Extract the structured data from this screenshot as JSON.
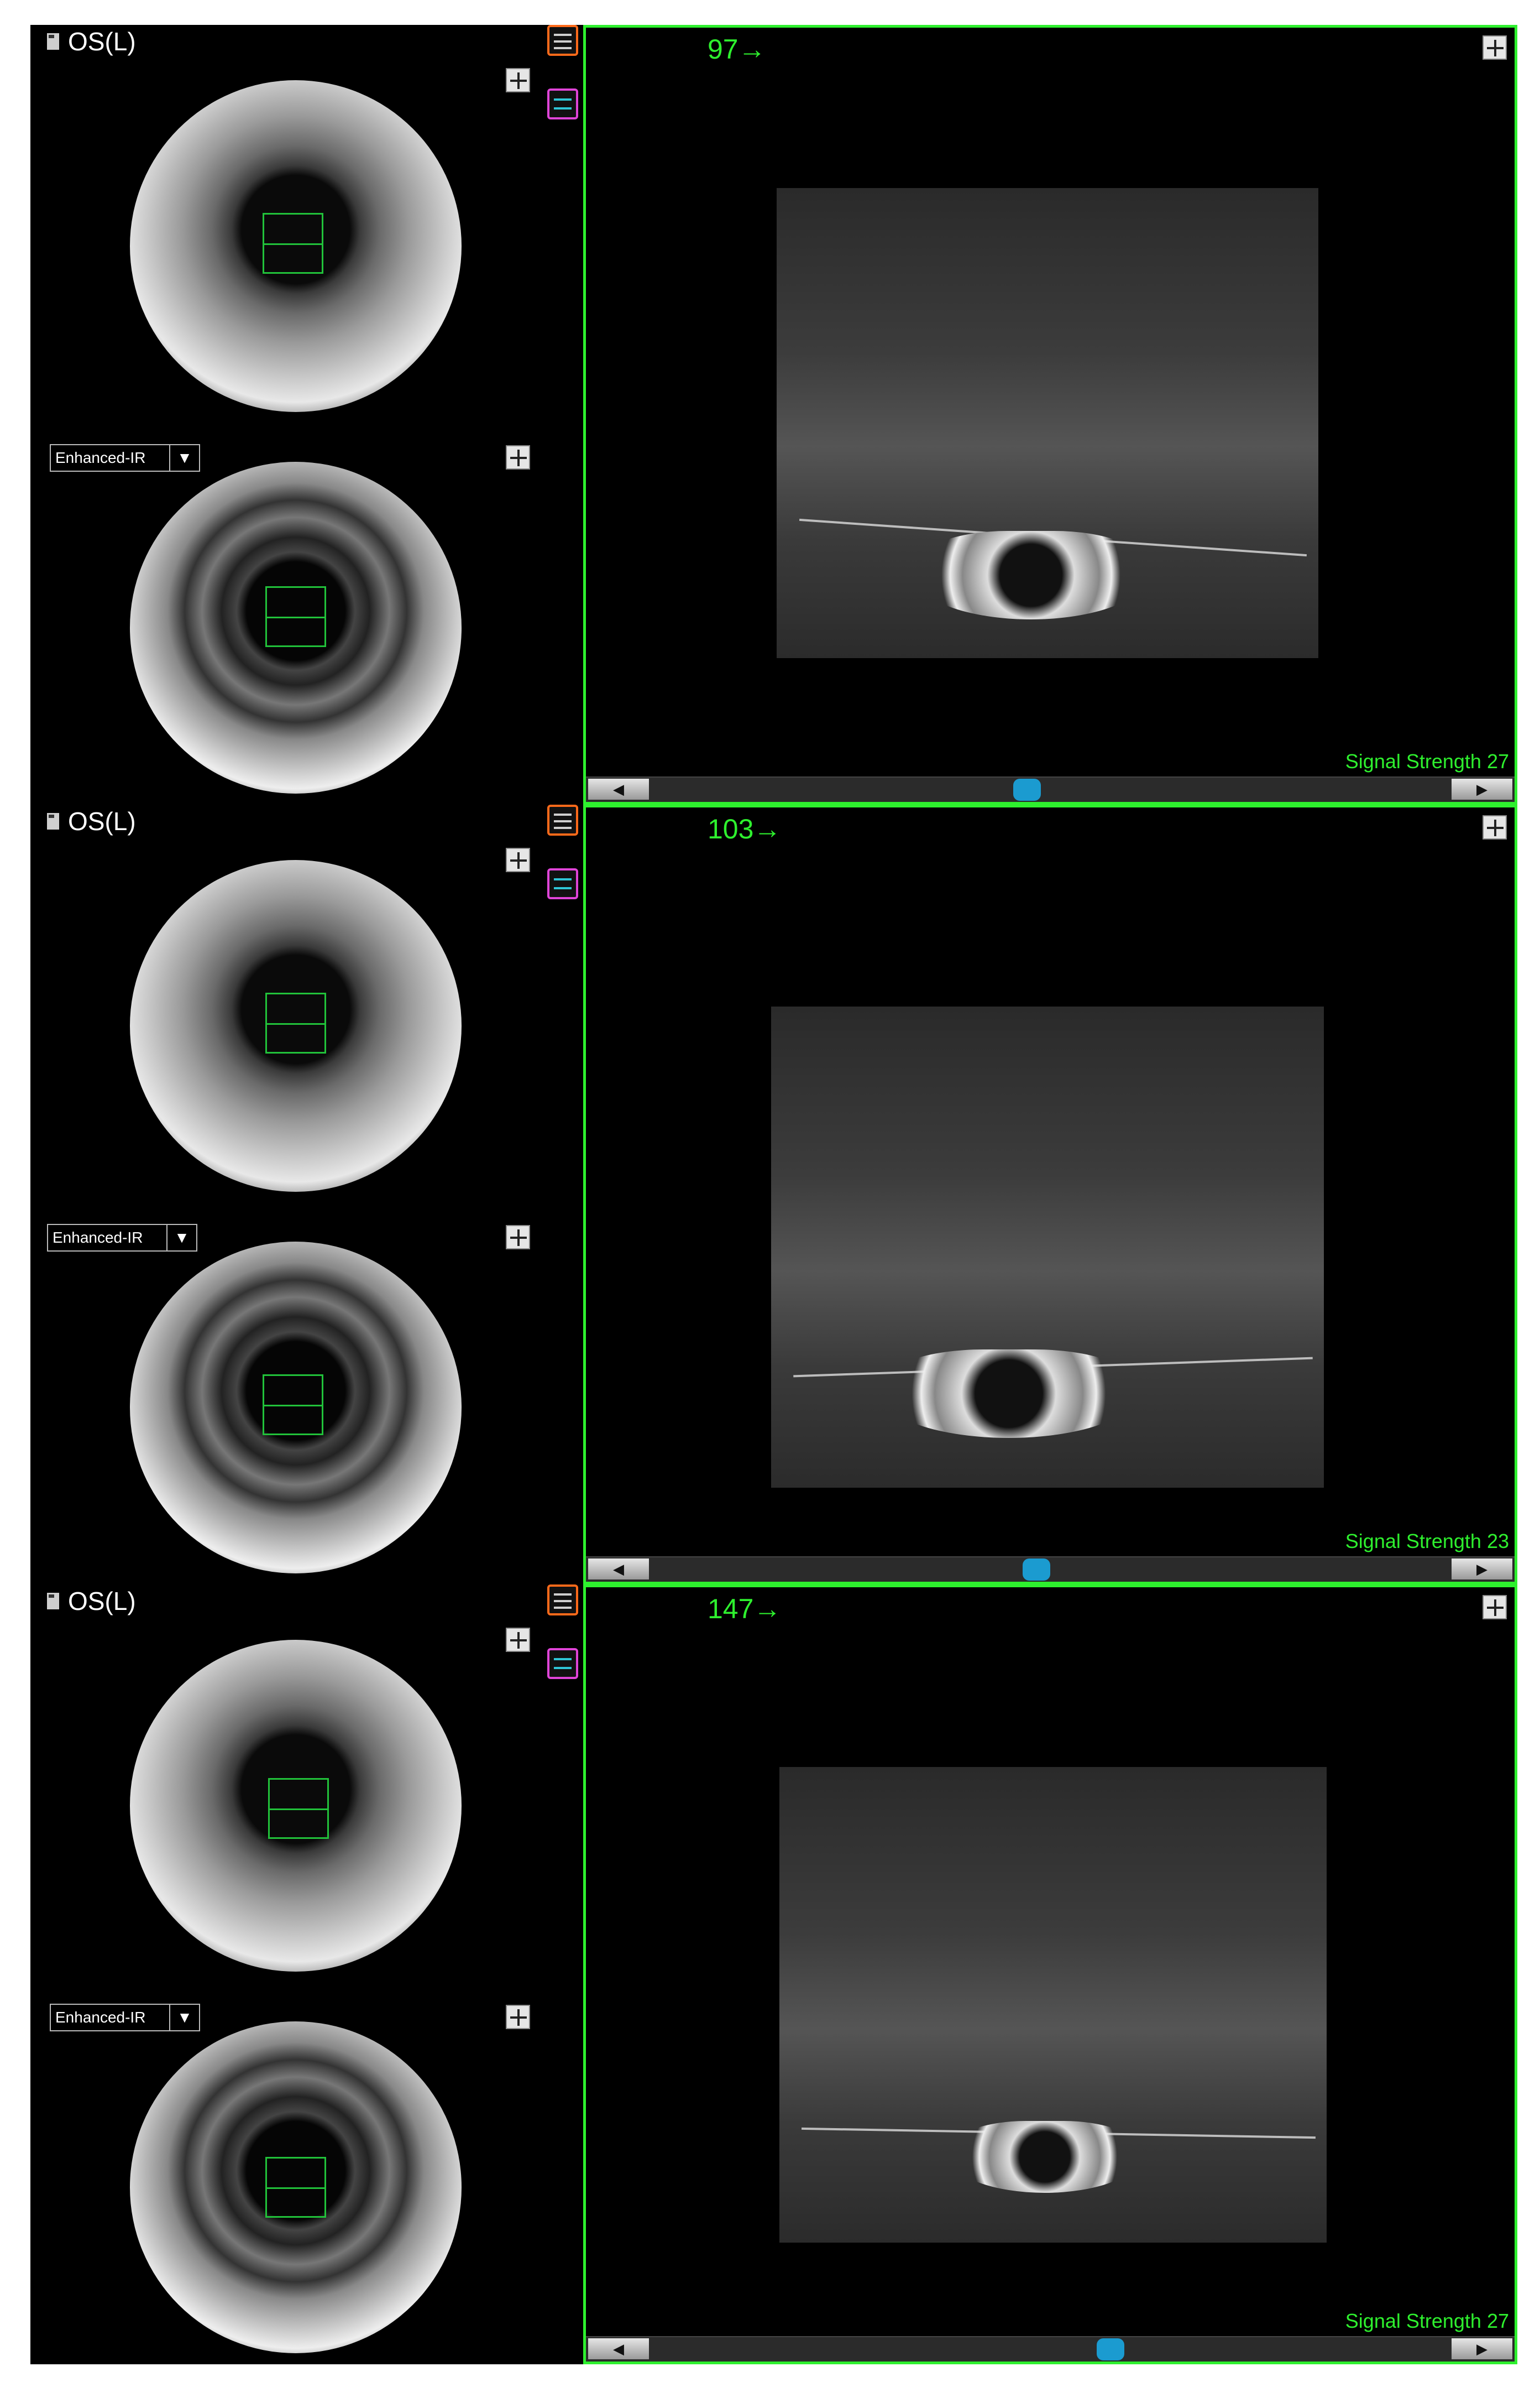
{
  "panels": [
    {
      "eye_label": "OS(L)",
      "dropdown_value": "Enhanced-IR",
      "oct_position_label": "97→",
      "signal_strength": "Signal Strength 27",
      "scroll_position_pct": 46
    },
    {
      "eye_label": "OS(L)",
      "dropdown_value": "Enhanced-IR",
      "oct_position_label": "103→",
      "signal_strength": "Signal Strength 23",
      "scroll_position_pct": 47
    },
    {
      "eye_label": "OS(L)",
      "dropdown_value": "Enhanced-IR",
      "oct_position_label": "147→",
      "signal_strength": "Signal Strength 27",
      "scroll_position_pct": 55
    }
  ],
  "icons": {
    "eye_doc": "document-icon",
    "tool_top": "layers-icon",
    "tool_bottom": "stack-icon",
    "expand": "expand-icon",
    "scroll_left": "arrow-left-icon",
    "scroll_right": "arrow-right-icon"
  },
  "colors": {
    "scan_box": "#21c23a",
    "oct_frame": "#2ef02e",
    "scroll_thumb": "#1b9bd0",
    "tool_top_border": "#ff6a1a",
    "tool_bottom_border": "#e044d8"
  }
}
